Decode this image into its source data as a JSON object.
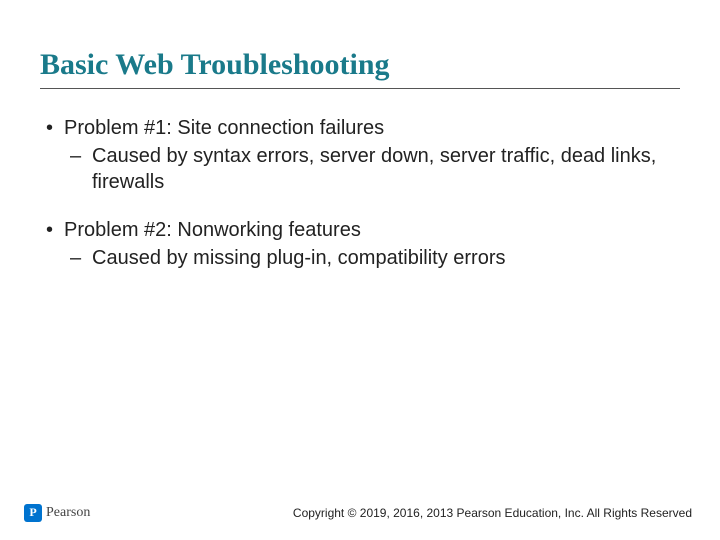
{
  "title": "Basic Web Troubleshooting",
  "bullets": [
    {
      "text": "Problem #1: Site connection failures",
      "sub": [
        "Caused by syntax errors, server down, server traffic, dead links, firewalls"
      ]
    },
    {
      "text": "Problem #2: Nonworking features",
      "sub": [
        "Caused by missing plug-in, compatibility errors"
      ]
    }
  ],
  "logo_text": "Pearson",
  "copyright": "Copyright © 2019, 2016, 2013 Pearson Education, Inc. All Rights Reserved"
}
